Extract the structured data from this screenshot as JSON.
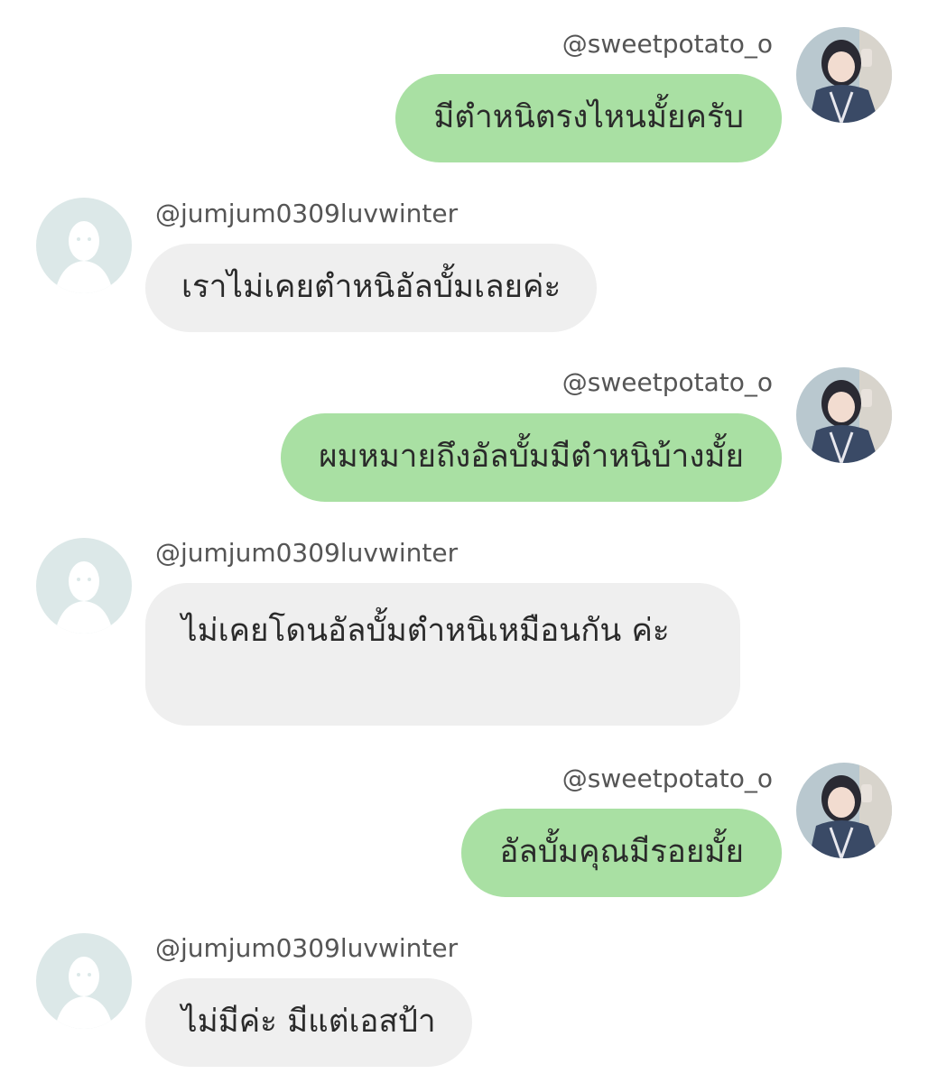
{
  "conversation": {
    "messages": [
      {
        "sender": "@sweetpotato_o",
        "text": "มีตำหนิตรงไหนมั้ยครับ",
        "direction": "sent",
        "avatar": "user-photo-avatar"
      },
      {
        "sender": "@jumjum0309luvwinter",
        "text": "เราไม่เคยตำหนิอัลบั้มเลยค่ะ",
        "direction": "received",
        "avatar": "default-silhouette-avatar"
      },
      {
        "sender": "@sweetpotato_o",
        "text": "ผมหมายถึงอัลบั้มมีตำหนิบ้างมั้ย",
        "direction": "sent",
        "avatar": "user-photo-avatar"
      },
      {
        "sender": "@jumjum0309luvwinter",
        "text": "ไม่เคยโดนอัลบั้มตำหนิเหมือนกัน ค่ะ",
        "direction": "received",
        "avatar": "default-silhouette-avatar"
      },
      {
        "sender": "@sweetpotato_o",
        "text": "อัลบั้มคุณมีรอยมั้ย",
        "direction": "sent",
        "avatar": "user-photo-avatar"
      },
      {
        "sender": "@jumjum0309luvwinter",
        "text": "ไม่มีค่ะ มีแต่เอสป้า",
        "direction": "received",
        "avatar": "default-silhouette-avatar"
      }
    ]
  },
  "colors": {
    "sent_bubble": "#a9e0a3",
    "received_bubble": "#efefef",
    "username_text": "#555555",
    "message_text": "#2a2a2a",
    "default_avatar_bg": "#dce8e8"
  }
}
